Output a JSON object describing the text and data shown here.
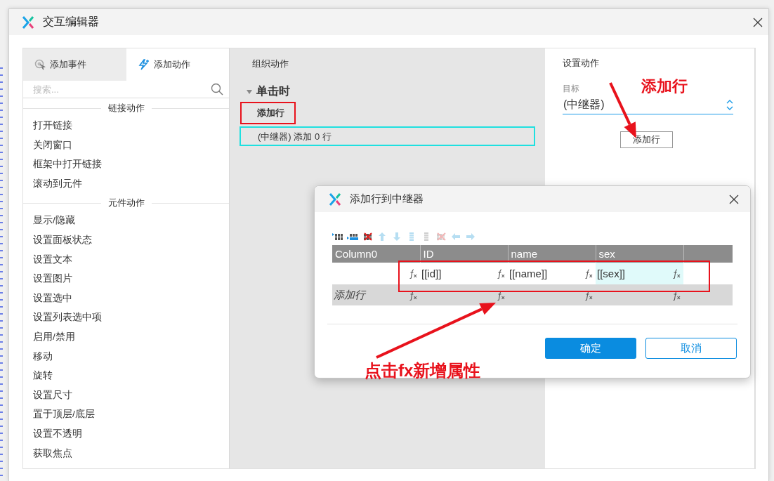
{
  "window": {
    "title": "交互编辑器"
  },
  "left_panel": {
    "tabs": [
      {
        "label": "添加事件",
        "kind": "event",
        "selected": false
      },
      {
        "label": "添加动作",
        "kind": "action",
        "selected": true
      }
    ],
    "search": {
      "placeholder": "搜索..."
    },
    "groups": [
      {
        "heading": "链接动作",
        "items": [
          "打开链接",
          "关闭窗口",
          "框架中打开链接",
          "滚动到元件"
        ]
      },
      {
        "heading": "元件动作",
        "items": [
          "显示/隐藏",
          "设置面板状态",
          "设置文本",
          "设置图片",
          "设置选中",
          "设置列表选中项",
          "启用/禁用",
          "移动",
          "旋转",
          "设置尺寸",
          "置于顶层/底层",
          "设置不透明",
          "获取焦点"
        ]
      }
    ]
  },
  "middle_panel": {
    "title": "组织动作",
    "event": {
      "label": "单击时",
      "expanded": true
    },
    "action": {
      "label": "添加行",
      "detail": "(中继器) 添加 0 行",
      "selected": true
    }
  },
  "right_panel": {
    "title": "设置动作",
    "target": {
      "label": "目标",
      "value": "(中继器)"
    },
    "button": "添加行"
  },
  "dialog": {
    "title": "添加行到中继器",
    "toolbar": [
      {
        "kind": "row-above",
        "disabled": false
      },
      {
        "kind": "row-below",
        "disabled": false
      },
      {
        "kind": "delete-row",
        "disabled": false
      },
      {
        "kind": "up",
        "disabled": true
      },
      {
        "kind": "down",
        "disabled": true
      },
      {
        "kind": "col-left",
        "disabled": true
      },
      {
        "kind": "col-right",
        "disabled": true
      },
      {
        "kind": "delete-col",
        "disabled": true
      },
      {
        "kind": "left",
        "disabled": true
      },
      {
        "kind": "right",
        "disabled": true
      }
    ],
    "columns": [
      "Column0",
      "ID",
      "name",
      "sex"
    ],
    "rows": [
      {
        "kind": "data",
        "cells": [
          {
            "editing": false
          },
          {
            "value": "[[id]]",
            "editing": false
          },
          {
            "value": "[[name]]",
            "editing": false
          },
          {
            "value": "[[sex]]",
            "editing": true
          }
        ]
      },
      {
        "kind": "new",
        "placeholder": "添加行"
      }
    ],
    "buttons": [
      {
        "label": "确定",
        "kind": "primary"
      },
      {
        "label": "取消",
        "kind": "secondary"
      }
    ]
  },
  "annotations": {
    "top_note": "添加行",
    "bottom_note": "点击fx新增属性"
  }
}
